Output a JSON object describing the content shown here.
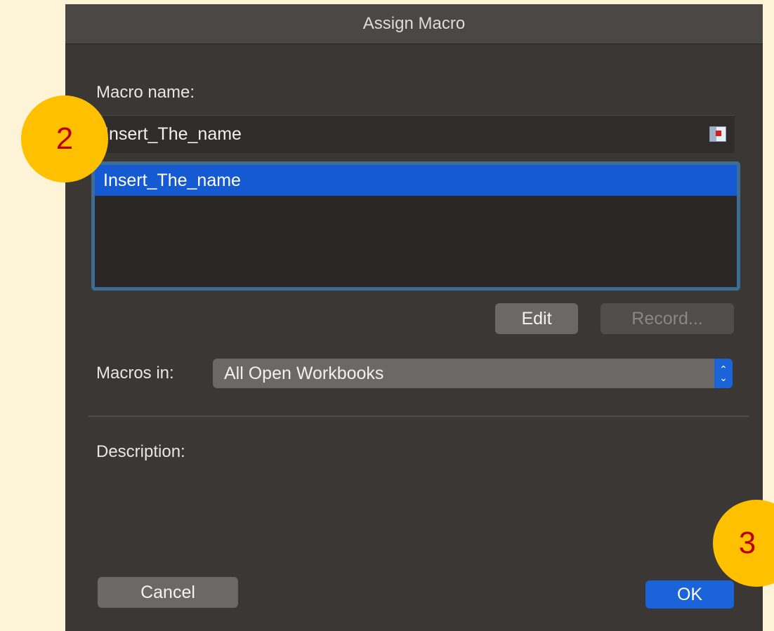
{
  "dialog": {
    "title": "Assign Macro",
    "macro_name_label": "Macro name:",
    "macro_name_value": "Insert_The_name",
    "macro_list": [
      "Insert_The_name"
    ],
    "edit_label": "Edit",
    "record_label": "Record...",
    "macros_in_label": "Macros in:",
    "macros_in_value": "All Open Workbooks",
    "description_label": "Description:",
    "cancel_label": "Cancel",
    "ok_label": "OK"
  },
  "annotations": {
    "step2": "2",
    "step3": "3"
  },
  "colors": {
    "accent": "#1a63d8",
    "badge": "#ffc000",
    "badge_text": "#c00000"
  }
}
